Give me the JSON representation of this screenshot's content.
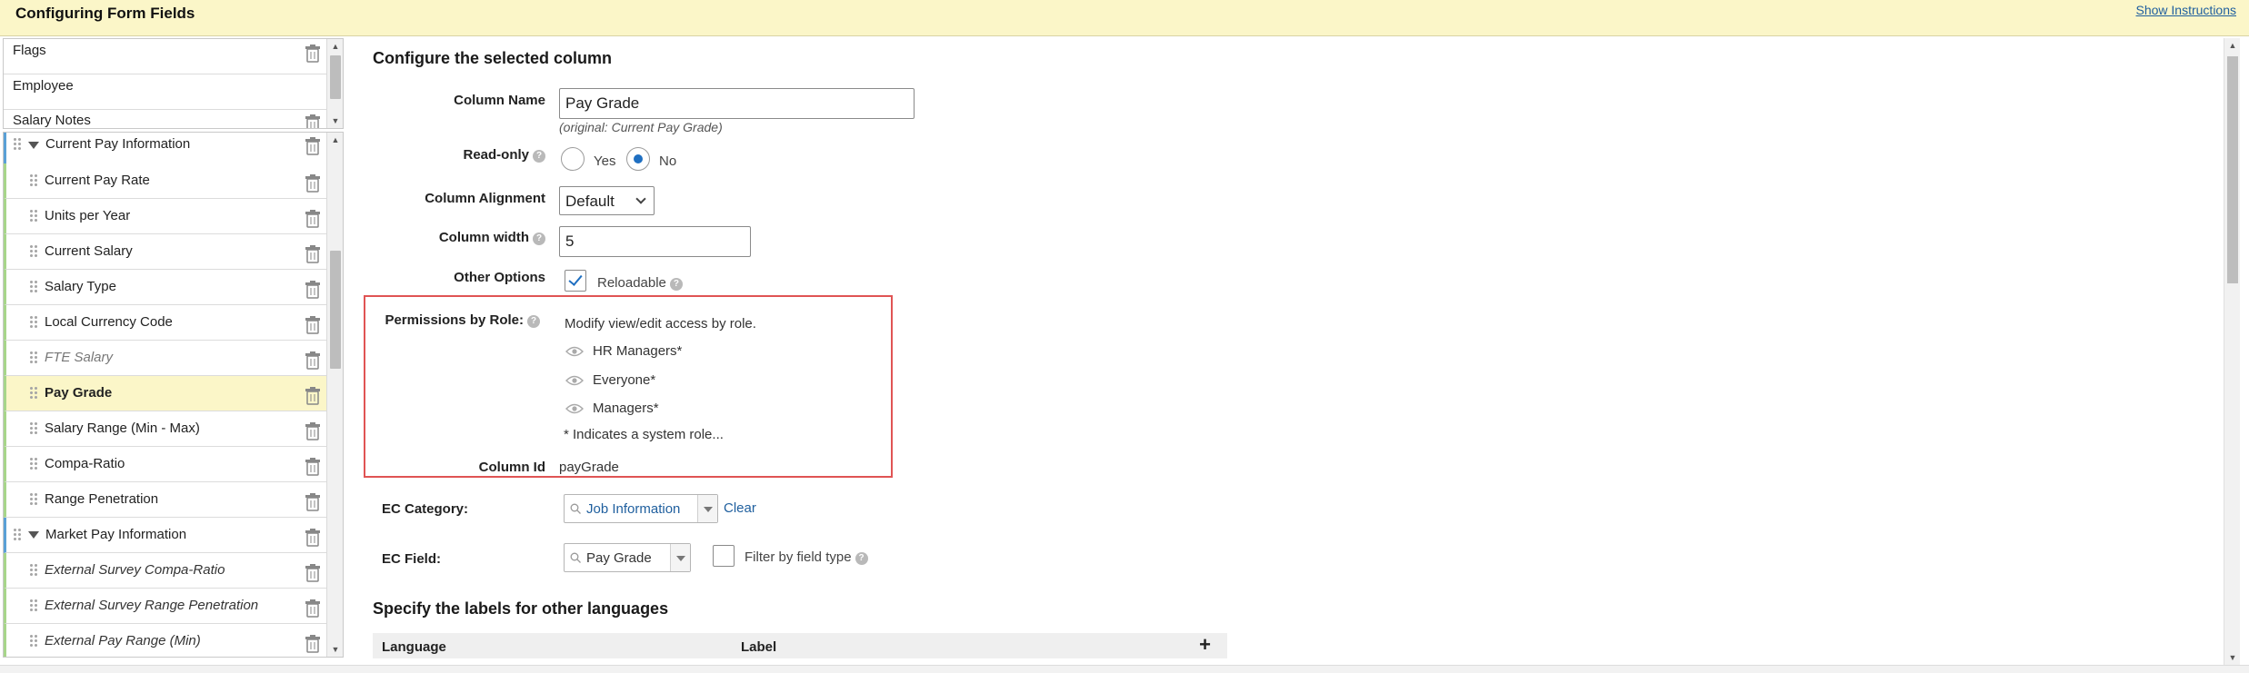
{
  "header": {
    "title": "Configuring Form Fields",
    "instructions_link": "Show Instructions"
  },
  "top_list": {
    "items": [
      {
        "label": "Flags"
      },
      {
        "label": "Employee"
      },
      {
        "label": "Salary Notes"
      }
    ]
  },
  "field_tree": {
    "groups": [
      {
        "label": "Current Pay Information"
      },
      {
        "label": "Market Pay Information"
      }
    ],
    "items": [
      {
        "label": "Current Pay Rate"
      },
      {
        "label": "Units per Year"
      },
      {
        "label": "Current Salary"
      },
      {
        "label": "Salary Type"
      },
      {
        "label": "Local Currency Code"
      },
      {
        "label": "FTE Salary"
      },
      {
        "label": "Pay Grade"
      },
      {
        "label": "Salary Range (Min - Max)"
      },
      {
        "label": "Compa-Ratio"
      },
      {
        "label": "Range Penetration"
      },
      {
        "label": "External Survey Compa-Ratio"
      },
      {
        "label": "External Survey Range Penetration"
      },
      {
        "label": "External Pay Range (Min)"
      }
    ]
  },
  "configure": {
    "heading": "Configure the selected column",
    "column_name": {
      "label": "Column Name",
      "value": "Pay Grade",
      "original_note": "(original: Current Pay Grade)"
    },
    "read_only": {
      "label": "Read-only",
      "yes": "Yes",
      "no": "No",
      "selected": "No"
    },
    "column_alignment": {
      "label": "Column Alignment",
      "value": "Default"
    },
    "column_width": {
      "label": "Column width",
      "value": "5"
    },
    "other_options": {
      "label": "Other Options",
      "reloadable_label": "Reloadable",
      "reloadable_checked": true
    },
    "permissions": {
      "label": "Permissions by Role:",
      "intro": "Modify view/edit access by role.",
      "roles": [
        "HR Managers*",
        "Everyone*",
        "Managers*"
      ],
      "footnote": "* Indicates a system role..."
    },
    "column_id": {
      "label": "Column Id",
      "value": "payGrade"
    },
    "ec_category": {
      "label": "EC Category:",
      "value": "Job Information",
      "clear": "Clear"
    },
    "ec_field": {
      "label": "EC Field:",
      "value": "Pay Grade",
      "filter_label": "Filter by field type"
    }
  },
  "languages": {
    "heading": "Specify the labels for other languages",
    "col_language": "Language",
    "col_label": "Label",
    "add": "+"
  },
  "colors": {
    "header_bg": "#fbf6c8",
    "selected_row_bg": "#fbf6c8",
    "link": "#1f5f9e",
    "highlight_border": "#e05454",
    "accent": "#1f6fc1"
  }
}
